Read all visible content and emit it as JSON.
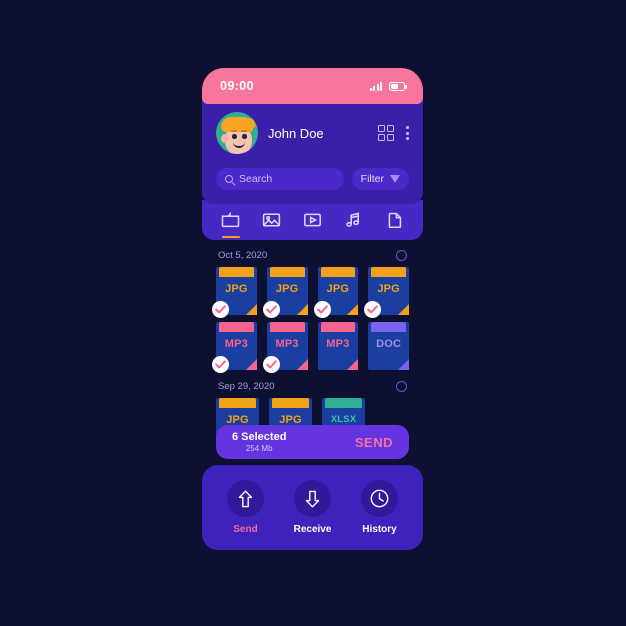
{
  "theme": {
    "page_bg": "#0d1030",
    "accent_pink": "#f8759b",
    "card_purple": "#3a20a8",
    "tabbar_purple": "#4628c4",
    "file_blue": "#1a3fa0",
    "orange": "#f2a118",
    "teal": "#2fae93",
    "violet": "#7a63ee"
  },
  "statusbar": {
    "time": "09:00",
    "signal_icon": "signal-bars-icon",
    "battery_icon": "battery-icon"
  },
  "header": {
    "avatar_name": "user-avatar",
    "username": "John Doe",
    "grid_icon": "grid-view-icon",
    "menu_icon": "more-vertical-icon"
  },
  "search": {
    "placeholder": "Search",
    "icon": "search-icon",
    "filter_label": "Filter",
    "filter_icon": "funnel-icon"
  },
  "tabs": [
    {
      "name": "folder",
      "icon": "folder-icon",
      "active": true
    },
    {
      "name": "images",
      "icon": "image-icon",
      "active": false
    },
    {
      "name": "video",
      "icon": "video-play-icon",
      "active": false
    },
    {
      "name": "music",
      "icon": "music-note-icon",
      "active": false
    },
    {
      "name": "documents",
      "icon": "document-icon",
      "active": false
    }
  ],
  "groups": [
    {
      "date": "Oct 5, 2020",
      "select_icon": "circle-unselected-icon",
      "rows": [
        [
          {
            "ext": "JPG",
            "top_color": "#f2a118",
            "text_color": "#f2a118",
            "corner_color": "#f2a118",
            "selected": true
          },
          {
            "ext": "JPG",
            "top_color": "#f2a118",
            "text_color": "#f2a118",
            "corner_color": "#f2a118",
            "selected": true
          },
          {
            "ext": "JPG",
            "top_color": "#f2a118",
            "text_color": "#f2a118",
            "corner_color": "#f2a118",
            "selected": true
          },
          {
            "ext": "JPG",
            "top_color": "#f2a118",
            "text_color": "#f2a118",
            "corner_color": "#f2a118",
            "selected": true
          }
        ],
        [
          {
            "ext": "MP3",
            "top_color": "#f5648f",
            "text_color": "#f5648f",
            "corner_color": "#f5648f",
            "selected": true
          },
          {
            "ext": "MP3",
            "top_color": "#f5648f",
            "text_color": "#f5648f",
            "corner_color": "#f5648f",
            "selected": true
          },
          {
            "ext": "MP3",
            "top_color": "#f5648f",
            "text_color": "#f5648f",
            "corner_color": "#f5648f",
            "selected": false
          },
          {
            "ext": "DOC",
            "top_color": "#7a63ee",
            "text_color": "#9f8df0",
            "corner_color": "#7a63ee",
            "selected": false
          }
        ]
      ]
    },
    {
      "date": "Sep 29, 2020",
      "select_icon": "circle-unselected-icon",
      "rows": [
        [
          {
            "ext": "JPG",
            "top_color": "#f2a118",
            "text_color": "#f2a118",
            "corner_color": "#f2a118",
            "selected": false
          },
          {
            "ext": "JPG",
            "top_color": "#f2a118",
            "text_color": "#f2a118",
            "corner_color": "#f2a118",
            "selected": false
          },
          {
            "ext": "XLSX",
            "top_color": "#2fae93",
            "text_color": "#3fc3a6",
            "corner_color": "#2fae93",
            "selected": false
          }
        ]
      ]
    }
  ],
  "selection_bar": {
    "count_label": "6 Selected",
    "size_label": "254 Mb",
    "send_label": "SEND"
  },
  "bottom_nav": [
    {
      "label": "Send",
      "icon": "arrow-up-icon",
      "active": true
    },
    {
      "label": "Receive",
      "icon": "arrow-down-icon",
      "active": false
    },
    {
      "label": "History",
      "icon": "clock-icon",
      "active": false
    }
  ]
}
